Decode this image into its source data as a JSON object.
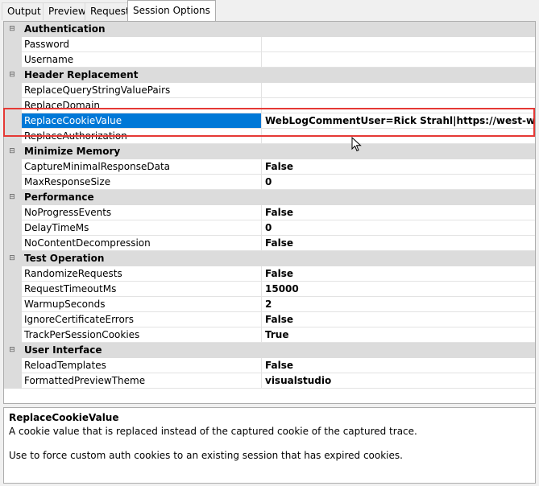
{
  "tabs": [
    "Output",
    "Preview",
    "Request",
    "Session Options"
  ],
  "active_tab": "Session Options",
  "grid": {
    "categories": [
      {
        "label": "Authentication",
        "properties": [
          {
            "name": "Password",
            "value": ""
          },
          {
            "name": "Username",
            "value": ""
          }
        ]
      },
      {
        "label": "Header Replacement",
        "properties": [
          {
            "name": "ReplaceQueryStringValuePairs",
            "value": ""
          },
          {
            "name": "ReplaceDomain",
            "value": ""
          },
          {
            "name": "ReplaceCookieValue",
            "value": "WebLogCommentUser=Rick Strahl|https://west-wind.com|r",
            "selected": true
          },
          {
            "name": "ReplaceAuthorization",
            "value": ""
          }
        ]
      },
      {
        "label": "Minimize Memory",
        "properties": [
          {
            "name": "CaptureMinimalResponseData",
            "value": "False"
          },
          {
            "name": "MaxResponseSize",
            "value": "0"
          }
        ]
      },
      {
        "label": "Performance",
        "properties": [
          {
            "name": "NoProgressEvents",
            "value": "False"
          },
          {
            "name": "DelayTimeMs",
            "value": "0"
          },
          {
            "name": "NoContentDecompression",
            "value": "False"
          }
        ]
      },
      {
        "label": "Test Operation",
        "properties": [
          {
            "name": "RandomizeRequests",
            "value": "False"
          },
          {
            "name": "RequestTimeoutMs",
            "value": "15000"
          },
          {
            "name": "WarmupSeconds",
            "value": "2"
          },
          {
            "name": "IgnoreCertificateErrors",
            "value": "False"
          },
          {
            "name": "TrackPerSessionCookies",
            "value": "True"
          }
        ]
      },
      {
        "label": "User Interface",
        "properties": [
          {
            "name": "ReloadTemplates",
            "value": "False"
          },
          {
            "name": "FormattedPreviewTheme",
            "value": "visualstudio"
          }
        ]
      }
    ]
  },
  "description": {
    "title": "ReplaceCookieValue",
    "line1": "A cookie value that is replaced instead of the captured cookie of the captured trace.",
    "line2": "Use to force custom auth cookies to an existing session that has expired cookies."
  },
  "colors": {
    "selection": "#0078d7",
    "category_bg": "#dcdcdc",
    "highlight_outline": "#e53935"
  },
  "icons": {
    "collapse": "minus-box-icon",
    "cursor": "mouse-pointer-icon"
  }
}
